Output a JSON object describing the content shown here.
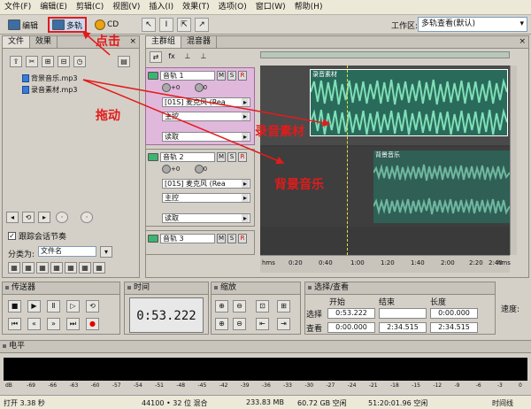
{
  "menu": [
    "文件(F)",
    "编辑(E)",
    "剪辑(C)",
    "视图(V)",
    "插入(I)",
    "效果(T)",
    "选项(O)",
    "窗口(W)",
    "帮助(H)"
  ],
  "toolbar": {
    "edit_label": "编辑",
    "multitrack_label": "多轨",
    "cd_label": "CD",
    "workspace_label": "工作区:",
    "workspace_value": "多轨查看(默认)"
  },
  "files_panel": {
    "tab_files": "文件",
    "tab_effects": "效果",
    "items": [
      "背景音乐.mp3",
      "录音素材.mp3"
    ],
    "follow_label": "跟踪会话节奏",
    "category_label": "分类为:",
    "category_value": "文件名"
  },
  "editor": {
    "tab_main": "主群组",
    "tab_mixer": "混音器"
  },
  "tracks": [
    {
      "name": "音轨 1",
      "input": "[01S] 麦克风 (Rea",
      "output": "主控",
      "auto": "读取"
    },
    {
      "name": "音轨 2",
      "input": "[01S] 麦克风 (Rea",
      "output": "主控",
      "auto": "读取"
    },
    {
      "name": "音轨 3"
    }
  ],
  "clips": [
    "录音素材",
    "背景音乐"
  ],
  "ruler_ticks": [
    "hms",
    "0:20",
    "0:40",
    "1:00",
    "1:20",
    "1:40",
    "2:00",
    "2:20",
    "2:40",
    "hms"
  ],
  "transport": {
    "title": "传送器"
  },
  "time": {
    "title": "时间",
    "value": "0:53.222"
  },
  "zoom": {
    "title": "缩放"
  },
  "selection": {
    "title": "选择/查看",
    "col_start": "开始",
    "col_end": "结束",
    "col_length": "长度",
    "row_select": "选择",
    "row_view": "查看",
    "select_start": "0:53.222",
    "select_end": "",
    "select_length": "0:00.000",
    "view_start": "0:00.000",
    "view_end": "2:34.515",
    "view_length": "2:34.515",
    "speed_label": "速度:"
  },
  "level": {
    "title": "电平",
    "db_labels": [
      "dB",
      "-69",
      "-66",
      "-63",
      "-60",
      "-57",
      "-54",
      "-51",
      "-48",
      "-45",
      "-42",
      "-39",
      "-36",
      "-33",
      "-30",
      "-27",
      "-24",
      "-21",
      "-18",
      "-15",
      "-12",
      "-9",
      "-6",
      "-3",
      "0"
    ]
  },
  "status": {
    "open_time": "打开 3.38 秒",
    "format": "44100 • 32 位 混合",
    "size": "233.83 MB",
    "free": "60.72 GB 空闲",
    "free_time": "51:20:01.96 空闲",
    "timeline": "时间线"
  },
  "annotations": {
    "click": "点击",
    "drag": "拖动",
    "rec_material": "录音素材",
    "bg_music": "背景音乐"
  },
  "colors": {
    "accent": "#e31b1b",
    "clip_wave": "#7fe0b8",
    "track_selected": "#e0b8dc"
  }
}
